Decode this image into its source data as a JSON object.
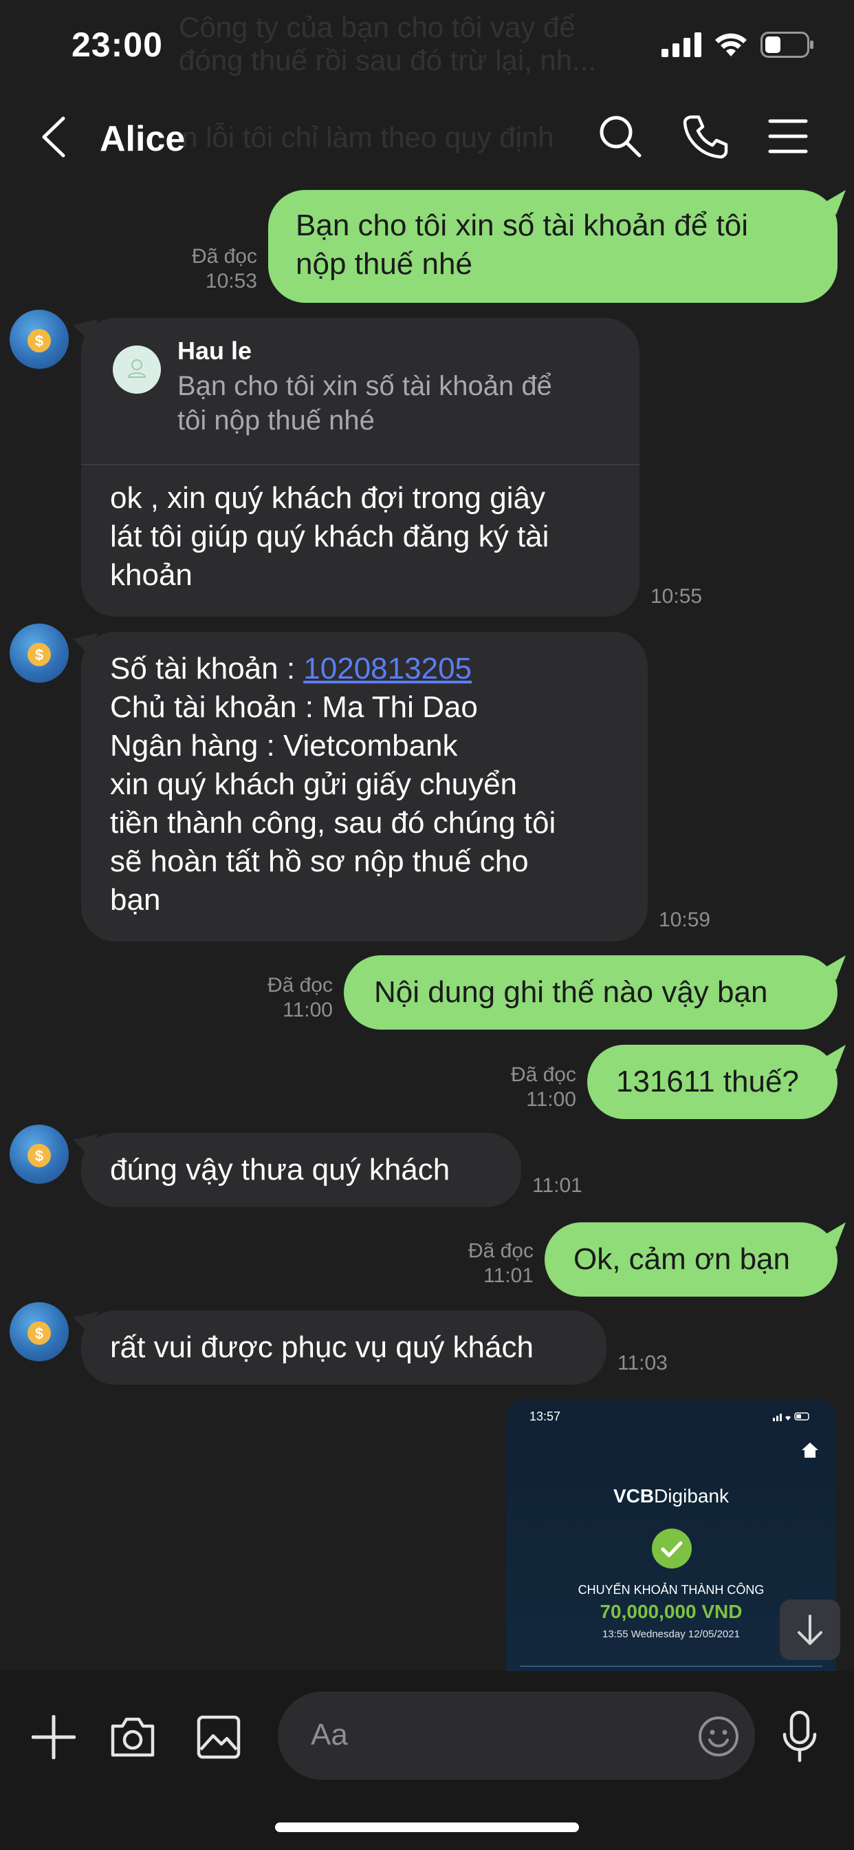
{
  "status_bar": {
    "time": "23:00"
  },
  "background_text": {
    "line1": "Công ty của bạn cho tôi vay để",
    "line2": "đóng thuế rồi sau đó trừ lại, nh...",
    "line3": "n lỗi tôi chỉ làm theo quy định"
  },
  "header": {
    "title": "Alice"
  },
  "messages": [
    {
      "text_l1": "Bạn cho tôi xin số tài khoản để tôi",
      "text_l2": "nộp thuế nhé",
      "read": "Đã đọc",
      "time": "10:53"
    },
    {
      "quote_name": "Hau le",
      "quote_l1": "Bạn cho tôi xin số tài khoản để",
      "quote_l2": "tôi nộp thuế nhé",
      "l1": "ok , xin quý khách đợi trong giây",
      "l2": "lát tôi giúp quý khách đăng ký tài",
      "l3": "khoản",
      "time": "10:55"
    },
    {
      "l1_label": "Số tài khoản : ",
      "account_number": "1020813205",
      "l2": "Chủ tài khoản : Ma Thi Dao",
      "l3": "Ngân hàng : Vietcombank",
      "l4": "xin quý khách gửi giấy chuyển",
      "l5": "tiền thành công, sau đó chúng tôi",
      "l6": "sẽ hoàn tất hồ sơ nộp thuế cho",
      "l7": "bạn",
      "time": "10:59"
    },
    {
      "text": "Nội dung ghi thế nào vậy bạn",
      "read": "Đã đọc",
      "time": "11:00"
    },
    {
      "text": "131611 thuế?",
      "read": "Đã đọc",
      "time": "11:00"
    },
    {
      "text": "đúng vậy thưa quý khách",
      "time": "11:01"
    },
    {
      "text": "Ok, cảm ơn bạn",
      "read": "Đã đọc",
      "time": "11:01"
    },
    {
      "text": "rất vui được phục vụ quý khách",
      "time": "11:03"
    }
  ],
  "image_preview": {
    "time": "13:57",
    "brand_bold": "VCB",
    "brand": "Digibank",
    "status": "CHUYỂN KHOẢN THÀNH CÔNG",
    "amount": "70,000,000 VND",
    "datetime": "13:55 Wednesday 12/05/2021"
  },
  "input": {
    "placeholder": "Aa"
  },
  "colors": {
    "outgoing": "#8fdc79",
    "incoming": "#2c2c2e",
    "background": "#1e1e1f",
    "link": "#5a7ef5",
    "success": "#7dc242"
  }
}
